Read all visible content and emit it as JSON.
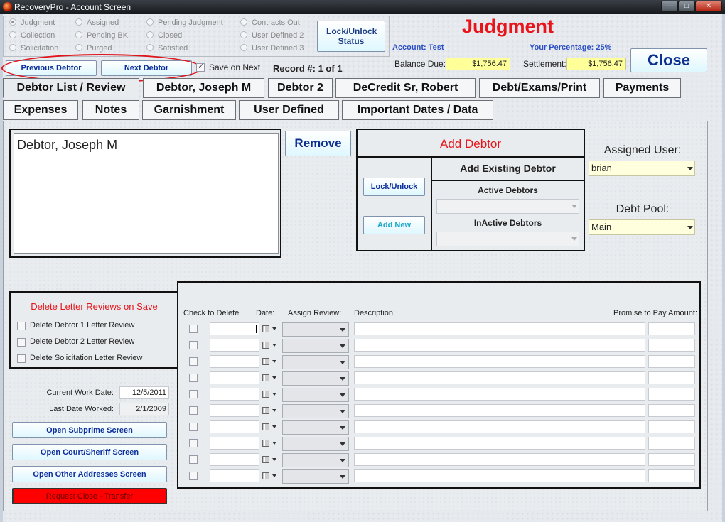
{
  "window": {
    "title": "RecoveryPro - Account Screen"
  },
  "status_radios": [
    {
      "label": "Judgment",
      "checked": true
    },
    {
      "label": "Collection",
      "checked": false
    },
    {
      "label": "Solicitation",
      "checked": false
    },
    {
      "label": "Assigned",
      "checked": false
    },
    {
      "label": "Pending BK",
      "checked": false
    },
    {
      "label": "Purged",
      "checked": false
    },
    {
      "label": "Pending Judgment",
      "checked": false
    },
    {
      "label": "Closed",
      "checked": false
    },
    {
      "label": "Satisfied",
      "checked": false
    },
    {
      "label": "Contracts Out",
      "checked": false
    },
    {
      "label": "User Defined 2",
      "checked": false
    },
    {
      "label": "User Defined 3",
      "checked": false
    }
  ],
  "header": {
    "lock_unlock_status": "Lock/Unlock Status",
    "status_title": "Judgment",
    "account_label": "Account:",
    "account_value": "Test",
    "percentage_label": "Your Percentage:",
    "percentage_value": "25%",
    "balance_label": "Balance Due:",
    "balance_value": "$1,756.47",
    "settlement_label": "Settlement:",
    "settlement_value": "$1,756.47",
    "close": "Close",
    "previous_debtor": "Previous Debtor",
    "next_debtor": "Next Debtor",
    "save_on_next": "Save on Next",
    "record_label": "Record #:",
    "record_value": "1 of 1"
  },
  "tabs_row1": [
    "Debtor List / Review",
    "Debtor, Joseph M",
    "Debtor 2",
    "DeCredit Sr, Robert",
    "Debt/Exams/Print",
    "Payments"
  ],
  "tabs_row2": [
    "Expenses",
    "Notes",
    "Garnishment",
    "User Defined",
    "Important Dates / Data"
  ],
  "debtor_list": {
    "items": [
      "Debtor, Joseph M"
    ],
    "remove": "Remove"
  },
  "add_debtor": {
    "title": "Add Debtor",
    "add_existing": "Add Existing Debtor",
    "lock_unlock": "Lock/Unlock",
    "add_new": "Add New",
    "active_label": "Active Debtors",
    "inactive_label": "InActive Debtors"
  },
  "assigned": {
    "user_label": "Assigned User:",
    "user_value": "brian",
    "pool_label": "Debt Pool:",
    "pool_value": "Main"
  },
  "delete_reviews": {
    "title": "Delete Letter Reviews on Save",
    "options": [
      "Delete Debtor 1 Letter Review",
      "Delete Debtor 2 Letter Review",
      "Delete Solicitation Letter Review"
    ]
  },
  "dates": {
    "work_label": "Current Work Date:",
    "work_value": "12/5/2011",
    "last_label": "Last Date Worked:",
    "last_value": "2/1/2009"
  },
  "actions": {
    "subprime": "Open Subprime Screen",
    "court": "Open Court/Sheriff Screen",
    "addresses": "Open Other Addresses Screen",
    "request_close": "Request Close - Transfer"
  },
  "review_table": {
    "headers": {
      "check": "Check to Delete",
      "date": "Date:",
      "assign": "Assign Review:",
      "desc": "Description:",
      "promise": "Promise to Pay Amount:"
    },
    "row_count": 10
  },
  "colors": {
    "accent_red": "#e8141a",
    "nav_blue": "#0c2f9c",
    "highlight_red": "#e0141a",
    "request_close_bg": "#ff0000"
  }
}
